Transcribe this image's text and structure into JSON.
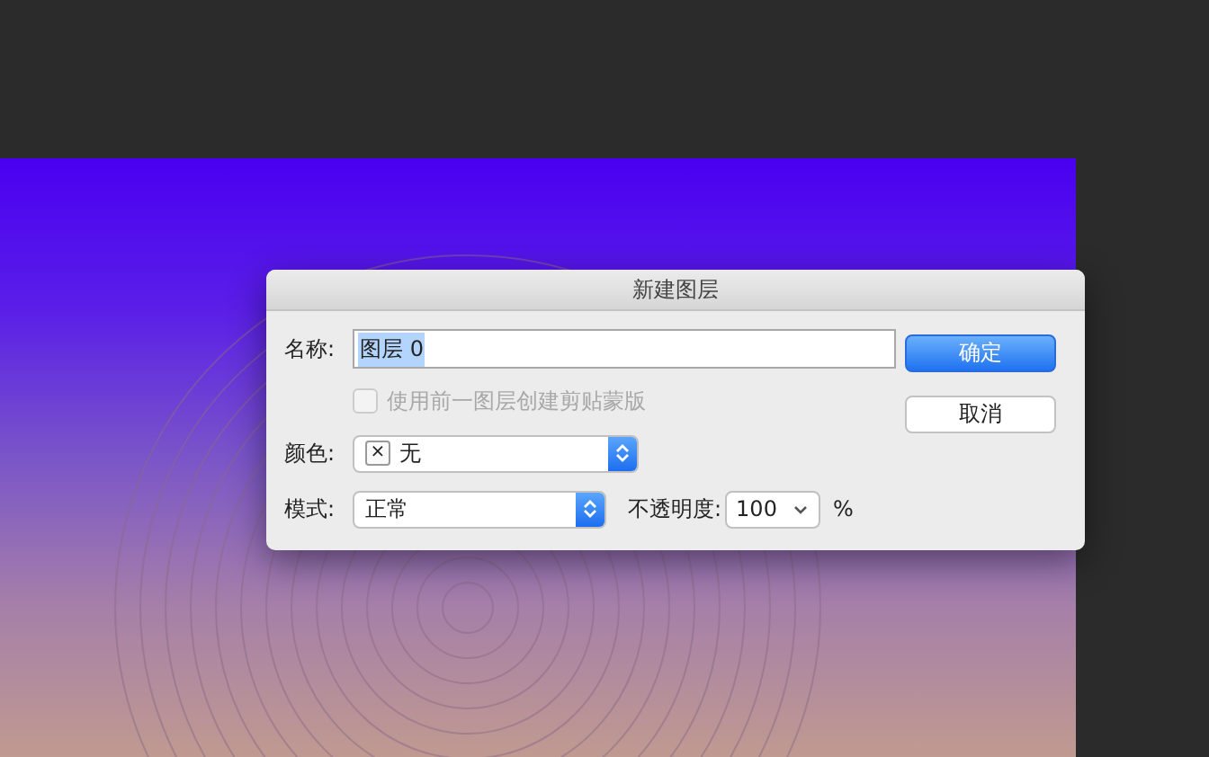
{
  "dialog": {
    "title": "新建图层",
    "name_field": {
      "label": "名称:",
      "value": "图层 0",
      "text_selected": true
    },
    "clip_checkbox": {
      "label": "使用前一图层创建剪贴蒙版",
      "checked": false,
      "disabled": true
    },
    "color_select": {
      "label": "颜色:",
      "swatch_symbol": "×",
      "value": "无"
    },
    "mode_select": {
      "label": "模式:",
      "value": "正常"
    },
    "opacity": {
      "label": "不透明度:",
      "value": "100",
      "unit": "%"
    },
    "buttons": [
      {
        "label": "确定",
        "default": true
      },
      {
        "label": "取消",
        "default": false
      }
    ]
  }
}
